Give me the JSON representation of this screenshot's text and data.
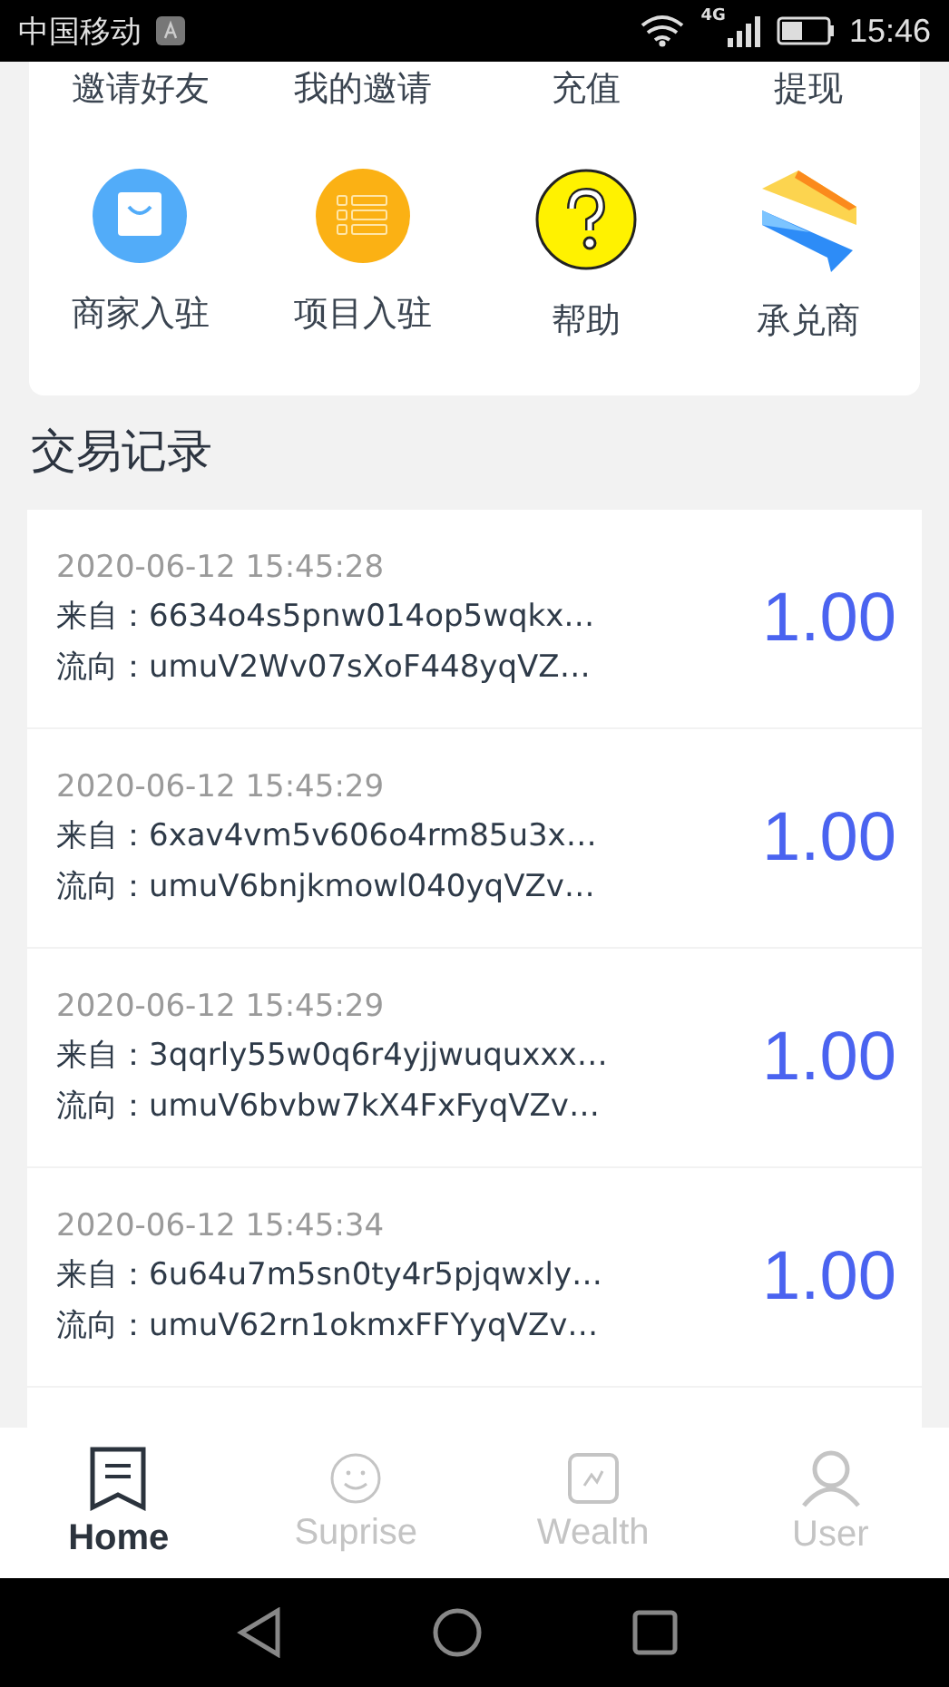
{
  "status_bar": {
    "carrier": "中国移动",
    "network": "4G",
    "time": "15:46"
  },
  "menu_rows": [
    {
      "show_icons": false,
      "items": [
        {
          "label": "邀请好友"
        },
        {
          "label": "我的邀请"
        },
        {
          "label": "充值"
        },
        {
          "label": "提现"
        }
      ]
    },
    {
      "show_icons": true,
      "items": [
        {
          "label": "商家入驻"
        },
        {
          "label": "项目入驻"
        },
        {
          "label": "帮助"
        },
        {
          "label": "承兑商"
        }
      ]
    }
  ],
  "section_title": "交易记录",
  "records": [
    {
      "time": "2020-06-12 15:45:28",
      "from": "来自：6634o4s5pnw014op5wqkx…",
      "to": "流向：umuV2Wv07sXoF448yqVZ…",
      "amount": "1.00"
    },
    {
      "time": "2020-06-12 15:45:29",
      "from": "来自：6xav4vm5v606o4rm85u3x…",
      "to": "流向：umuV6bnjkmowl040yqVZv…",
      "amount": "1.00"
    },
    {
      "time": "2020-06-12 15:45:29",
      "from": "来自：3qqrly55w0q6r4yjjwuquxxx…",
      "to": "流向：umuV6bvbw7kX4FxFyqVZv…",
      "amount": "1.00"
    },
    {
      "time": "2020-06-12 15:45:34",
      "from": "来自：6u64u7m5sn0ty4r5pjqwxly…",
      "to": "流向：umuV62rn1okmxFFYyqVZv…",
      "amount": "1.00"
    }
  ],
  "tabs": [
    {
      "label": "Home",
      "selected": true
    },
    {
      "label": "Suprise",
      "selected": false
    },
    {
      "label": "Wealth",
      "selected": false
    },
    {
      "label": "User",
      "selected": false
    }
  ]
}
